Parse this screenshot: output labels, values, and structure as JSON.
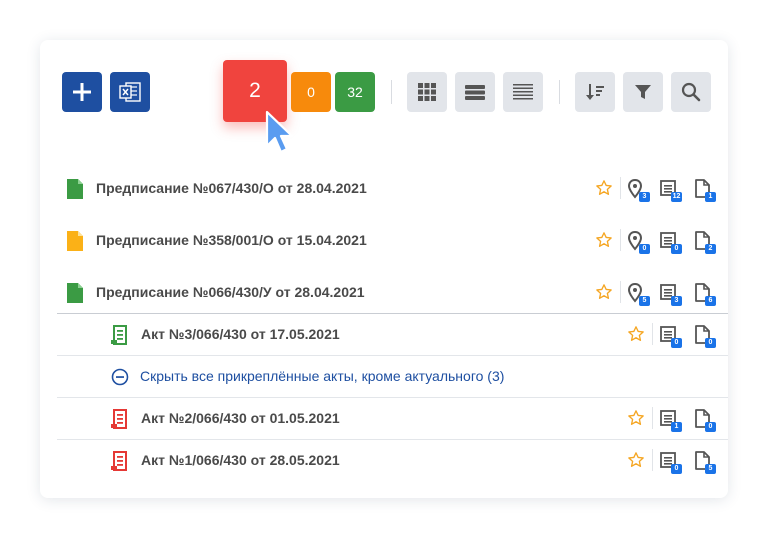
{
  "toolbar": {
    "add_label": "Добавить",
    "excel_label": "Экспорт в Excel",
    "counters": [
      {
        "value": "2",
        "color": "#f0443e"
      },
      {
        "value": "0",
        "color": "#f78a0c"
      },
      {
        "value": "32",
        "color": "#3b9b44"
      }
    ],
    "view_buttons": [
      "grid-view-icon",
      "list-view-icon",
      "compact-view-icon"
    ],
    "tools": [
      "sort-icon",
      "filter-icon",
      "search-icon"
    ]
  },
  "prescriptions": [
    {
      "title": "Предписание №067/430/О от 28.04.2021",
      "icon_color": "#3b9b44",
      "badges": [
        "3",
        "12",
        "1"
      ]
    },
    {
      "title": "Предписание №358/001/О от 15.04.2021",
      "icon_color": "#fbb117",
      "badges": [
        "0",
        "0",
        "2"
      ]
    },
    {
      "title": "Предписание №066/430/У от 28.04.2021",
      "icon_color": "#3b9b44",
      "badges": [
        "5",
        "3",
        "6"
      ]
    }
  ],
  "acts": [
    {
      "title": "Акт №3/066/430 от 17.05.2021",
      "icon_color": "#3b9b44",
      "badges": [
        "0",
        "0"
      ]
    },
    {
      "title": "Акт №2/066/430 от 01.05.2021",
      "icon_color": "#e53935",
      "badges": [
        "1",
        "0"
      ]
    },
    {
      "title": "Акт №1/066/430 от 28.05.2021",
      "icon_color": "#e53935",
      "badges": [
        "0",
        "5"
      ]
    }
  ],
  "hide_acts_text": "Скрыть все прикреплённые акты, кроме актуального (3)",
  "colors": {
    "primary": "#1e4fa1",
    "badge": "#1a73e8",
    "star": "#f5a623"
  }
}
